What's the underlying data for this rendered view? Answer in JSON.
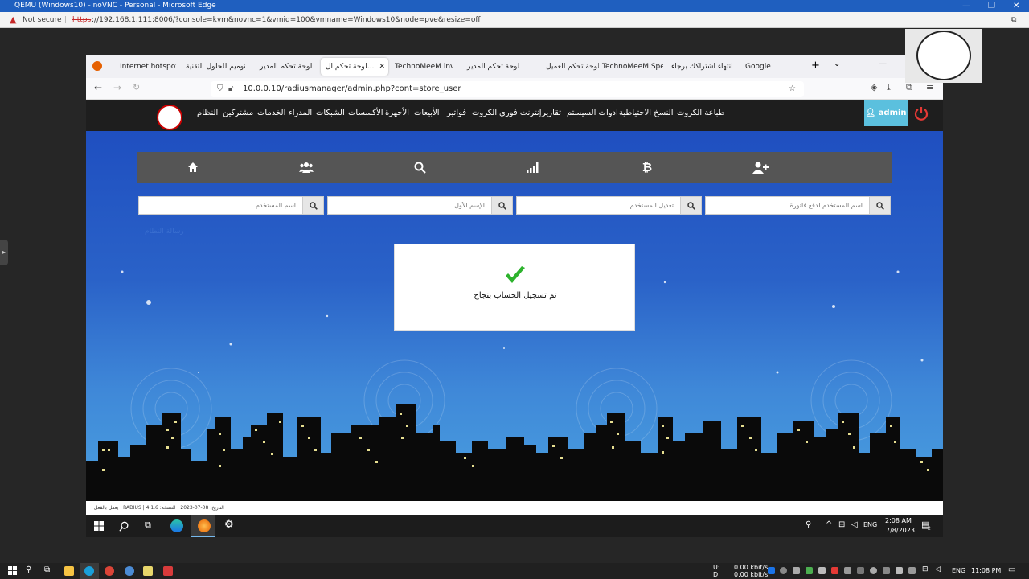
{
  "edge": {
    "title": "QEMU (Windows10) - noVNC - Personal - Microsoft Edge",
    "not_secure": "Not secure",
    "url_https": "https",
    "url_rest": "://192.168.1.111:8006/?console=kvm&novnc=1&vmid=100&vmname=Windows10&node=pve&resize=off"
  },
  "firefox": {
    "tabs": [
      {
        "label": "Internet hotspot"
      },
      {
        "label": "تكنوميم للحلول التقنية"
      },
      {
        "label": "لوحة تحكم المدير"
      },
      {
        "label": "لوحة تحكم ال..."
      },
      {
        "label": "TechnoMeeM invoic"
      },
      {
        "label": "لوحة تحكم المدير"
      },
      {
        "label": "لوحة تحكم العميل"
      },
      {
        "label": "TechnoMeeM Speed"
      },
      {
        "label": "تم انتهاء اشتراكك برجاء"
      },
      {
        "label": "Google"
      }
    ],
    "url": "10.0.0.10/radiusmanager/admin.php?cont=store_user"
  },
  "site": {
    "admin_label": "admin",
    "menu": [
      "طباعة الكروت",
      "النسخ الاحتياطية",
      "ادوات السيستم",
      "تقارير",
      "إنترنت فوري",
      "الكروت",
      "فواتير",
      "الأبيعات",
      "الأجهزة",
      "الأكسسات",
      "الشبكات",
      "المدراء",
      "الخدمات",
      "مشتركين",
      "النظام"
    ],
    "search_placeholders": [
      "اسم المستخدم لدفع فاتورة",
      "تعديل المستخدم",
      "الإسم الأول",
      "اسم المستخدم"
    ],
    "status_link": "رسالة النظام",
    "success_message": "تم تسجيل الحساب بنجاح",
    "footer": "يعمل بالفعل | RADIUS | التاريخ: 08-07-2023 | النسخة: 4.1.6"
  },
  "inner_taskbar": {
    "lang": "ENG",
    "time": "2:08 AM",
    "date": "7/8/2023",
    "notif_count": "2"
  },
  "outer_taskbar": {
    "u_label": "U:",
    "d_label": "D:",
    "u_speed": "0.00 kbit/s",
    "d_speed": "0.00 kbit/s",
    "lang": "ENG",
    "time": "11:08 PM"
  },
  "colors": {
    "accent": "#5bc0de",
    "header": "#1e1e1e",
    "check": "#2db32d"
  }
}
